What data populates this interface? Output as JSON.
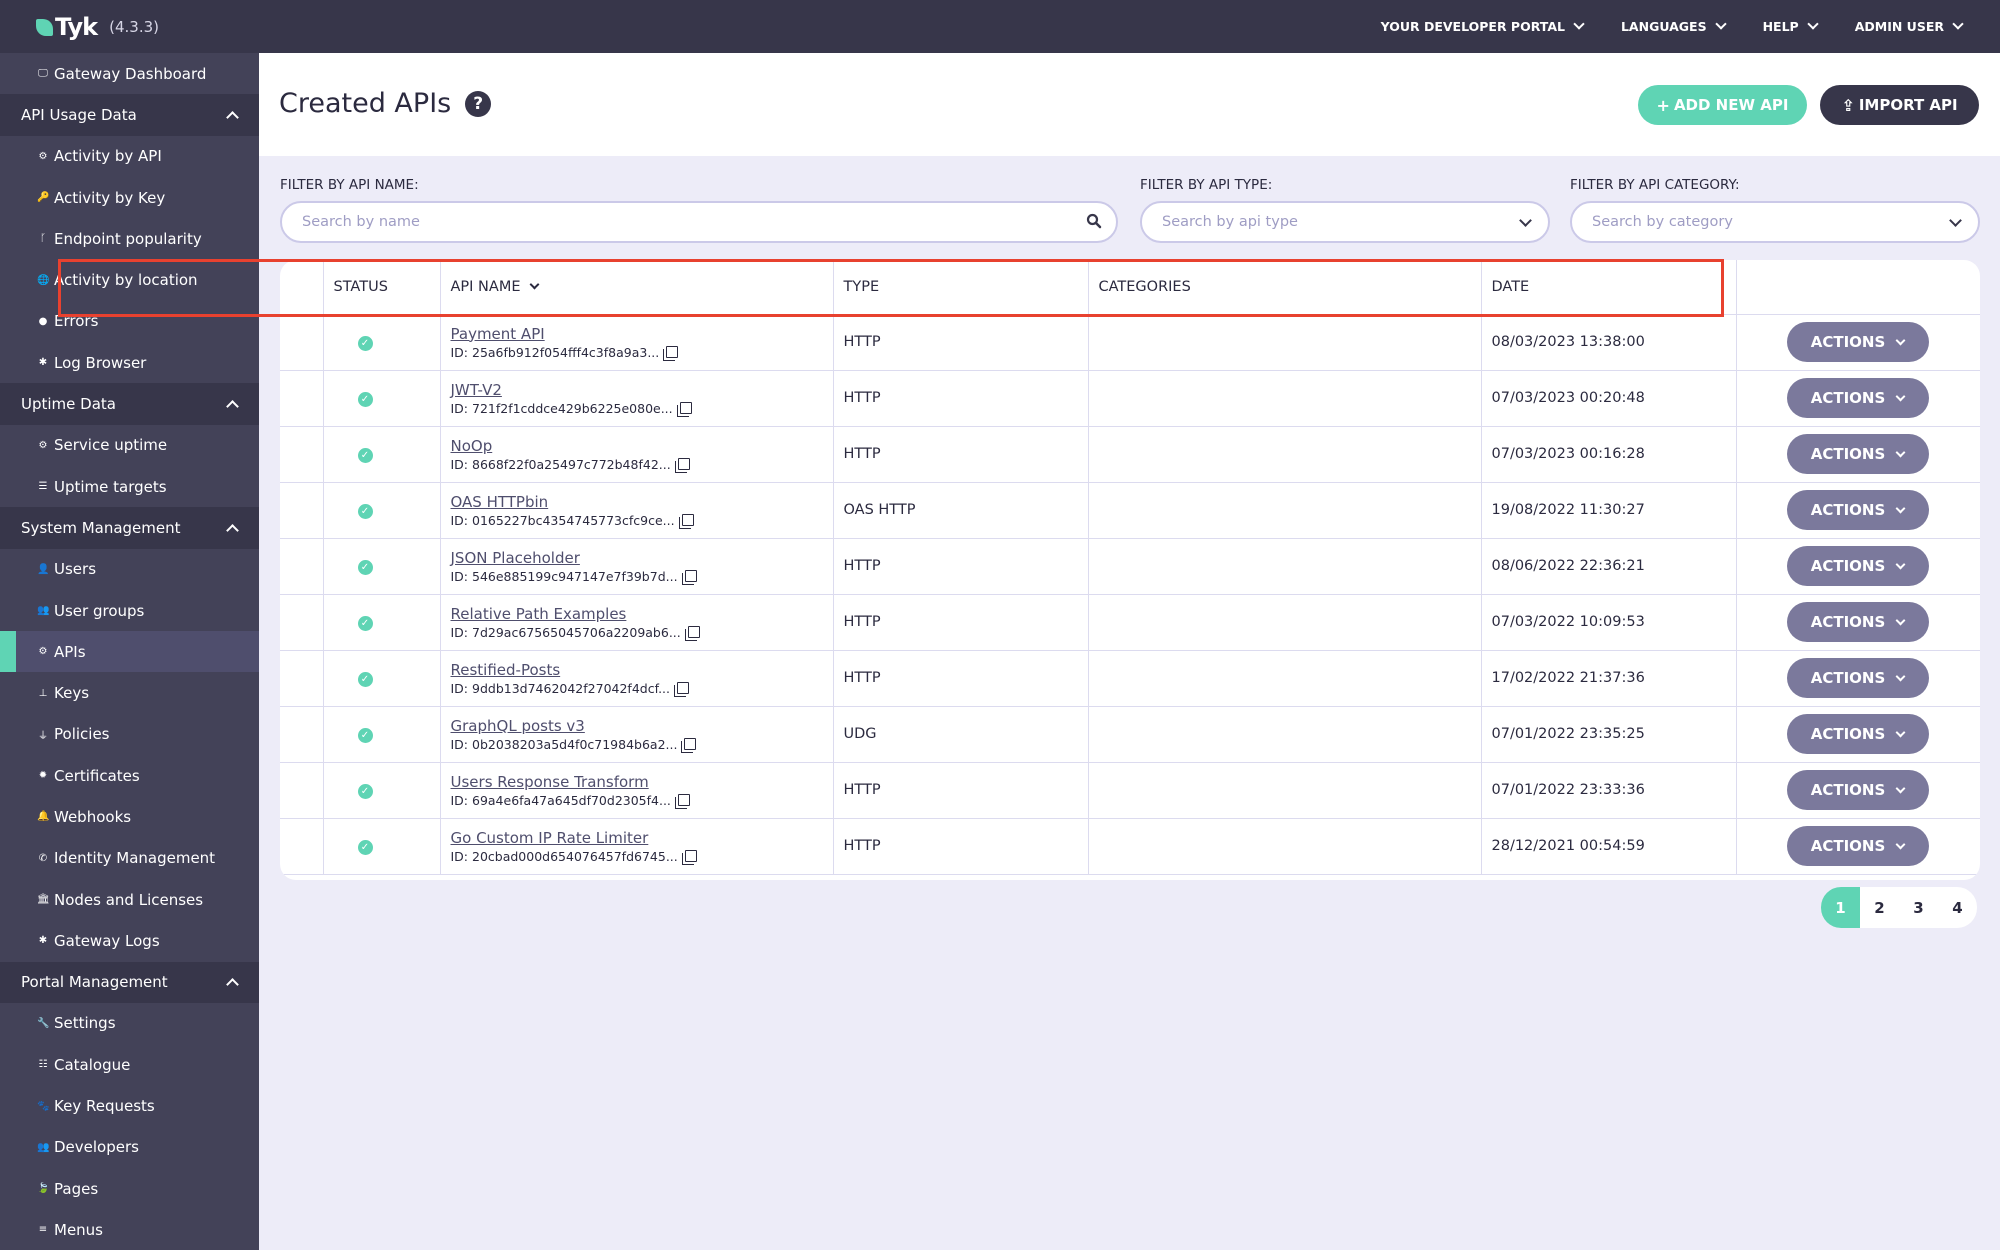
{
  "app": {
    "logo_text": "Tyk",
    "version": "(4.3.3)"
  },
  "topnav": [
    {
      "label": "YOUR DEVELOPER PORTAL"
    },
    {
      "label": "LANGUAGES"
    },
    {
      "label": "HELP"
    },
    {
      "label": "ADMIN USER"
    }
  ],
  "sidebar": {
    "top_item": {
      "label": "Gateway Dashboard",
      "icon": "monitor-icon",
      "glyph": "🖵"
    },
    "groups": [
      {
        "label": "API Usage Data",
        "items": [
          {
            "label": "Activity by API",
            "icon": "cogs-icon",
            "glyph": "⚙"
          },
          {
            "label": "Activity by Key",
            "icon": "key-icon",
            "glyph": "🔑"
          },
          {
            "label": "Endpoint popularity",
            "icon": "branch-icon",
            "glyph": "ᚴ"
          },
          {
            "label": "Activity by location",
            "icon": "globe-icon",
            "glyph": "🌐"
          },
          {
            "label": "Errors",
            "icon": "bomb-icon",
            "glyph": "●"
          },
          {
            "label": "Log Browser",
            "icon": "bug-icon",
            "glyph": "✱"
          }
        ]
      },
      {
        "label": "Uptime Data",
        "items": [
          {
            "label": "Service uptime",
            "icon": "cogs-icon",
            "glyph": "⚙"
          },
          {
            "label": "Uptime targets",
            "icon": "list-icon",
            "glyph": "☰"
          }
        ]
      },
      {
        "label": "System Management",
        "items": [
          {
            "label": "Users",
            "icon": "user-icon",
            "glyph": "👤"
          },
          {
            "label": "User groups",
            "icon": "users-icon",
            "glyph": "👥"
          },
          {
            "label": "APIs",
            "icon": "gears-icon",
            "glyph": "⚙",
            "active": true
          },
          {
            "label": "Keys",
            "icon": "sitemap-icon",
            "glyph": "⊥"
          },
          {
            "label": "Policies",
            "icon": "plug-icon",
            "glyph": "⏚"
          },
          {
            "label": "Certificates",
            "icon": "certificate-icon",
            "glyph": "✹"
          },
          {
            "label": "Webhooks",
            "icon": "bell-icon",
            "glyph": "🔔"
          },
          {
            "label": "Identity Management",
            "icon": "phone-icon",
            "glyph": "✆"
          },
          {
            "label": "Nodes and Licenses",
            "icon": "bank-icon",
            "glyph": "🏛"
          },
          {
            "label": "Gateway Logs",
            "icon": "bug-icon",
            "glyph": "✱"
          }
        ]
      },
      {
        "label": "Portal Management",
        "items": [
          {
            "label": "Settings",
            "icon": "wrench-icon",
            "glyph": "🔧"
          },
          {
            "label": "Catalogue",
            "icon": "list-alt-icon",
            "glyph": "☷"
          },
          {
            "label": "Key Requests",
            "icon": "paw-icon",
            "glyph": "🐾"
          },
          {
            "label": "Developers",
            "icon": "users-icon",
            "glyph": "👥"
          },
          {
            "label": "Pages",
            "icon": "leaf-icon",
            "glyph": "🍃"
          },
          {
            "label": "Menus",
            "icon": "bars-icon",
            "glyph": "≡"
          }
        ]
      }
    ]
  },
  "page": {
    "title": "Created APIs",
    "help_glyph": "?",
    "add_button": "ADD NEW API",
    "import_button": "IMPORT API"
  },
  "filters": {
    "name_label": "FILTER BY API NAME:",
    "name_placeholder": "Search by name",
    "type_label": "FILTER BY API TYPE:",
    "type_placeholder": "Search by api type",
    "category_label": "FILTER BY API CATEGORY:",
    "category_placeholder": "Search by category"
  },
  "table": {
    "headers": {
      "status": "STATUS",
      "name": "API NAME",
      "type": "TYPE",
      "categories": "CATEGORIES",
      "date": "DATE"
    },
    "actions_label": "ACTIONS",
    "rows": [
      {
        "name": "Payment API",
        "id": "ID: 25a6fb912f054fff4c3f8a9a3...",
        "type": "HTTP",
        "categories": "",
        "date": "08/03/2023 13:38:00",
        "highlighted": true
      },
      {
        "name": "JWT-V2",
        "id": "ID: 721f2f1cddce429b6225e080e...",
        "type": "HTTP",
        "categories": "",
        "date": "07/03/2023 00:20:48"
      },
      {
        "name": "NoOp",
        "id": "ID: 8668f22f0a25497c772b48f42...",
        "type": "HTTP",
        "categories": "",
        "date": "07/03/2023 00:16:28"
      },
      {
        "name": "OAS HTTPbin",
        "id": "ID: 0165227bc4354745773cfc9ce...",
        "type": "OAS HTTP",
        "categories": "",
        "date": "19/08/2022 11:30:27"
      },
      {
        "name": "JSON Placeholder",
        "id": "ID: 546e885199c947147e7f39b7d...",
        "type": "HTTP",
        "categories": "",
        "date": "08/06/2022 22:36:21"
      },
      {
        "name": "Relative Path Examples",
        "id": "ID: 7d29ac67565045706a2209ab6...",
        "type": "HTTP",
        "categories": "",
        "date": "07/03/2022 10:09:53"
      },
      {
        "name": "Restified-Posts",
        "id": "ID: 9ddb13d7462042f27042f4dcf...",
        "type": "HTTP",
        "categories": "",
        "date": "17/02/2022 21:37:36"
      },
      {
        "name": "GraphQL posts v3",
        "id": "ID: 0b2038203a5d4f0c71984b6a2...",
        "type": "UDG",
        "categories": "",
        "date": "07/01/2022 23:35:25"
      },
      {
        "name": "Users Response Transform",
        "id": "ID: 69a4e6fa47a645df70d2305f4...",
        "type": "HTTP",
        "categories": "",
        "date": "07/01/2022 23:33:36"
      },
      {
        "name": "Go Custom IP Rate Limiter",
        "id": "ID: 20cbad000d654076457fd6745...",
        "type": "HTTP",
        "categories": "",
        "date": "28/12/2021 00:54:59"
      }
    ]
  },
  "pagination": {
    "pages": [
      "1",
      "2",
      "3",
      "4"
    ],
    "current": "1"
  },
  "colors": {
    "accent": "#5fd4b4",
    "dark": "#37364a",
    "sidebar": "#434258",
    "actions": "#7b799c",
    "highlight": "#e8412f"
  }
}
